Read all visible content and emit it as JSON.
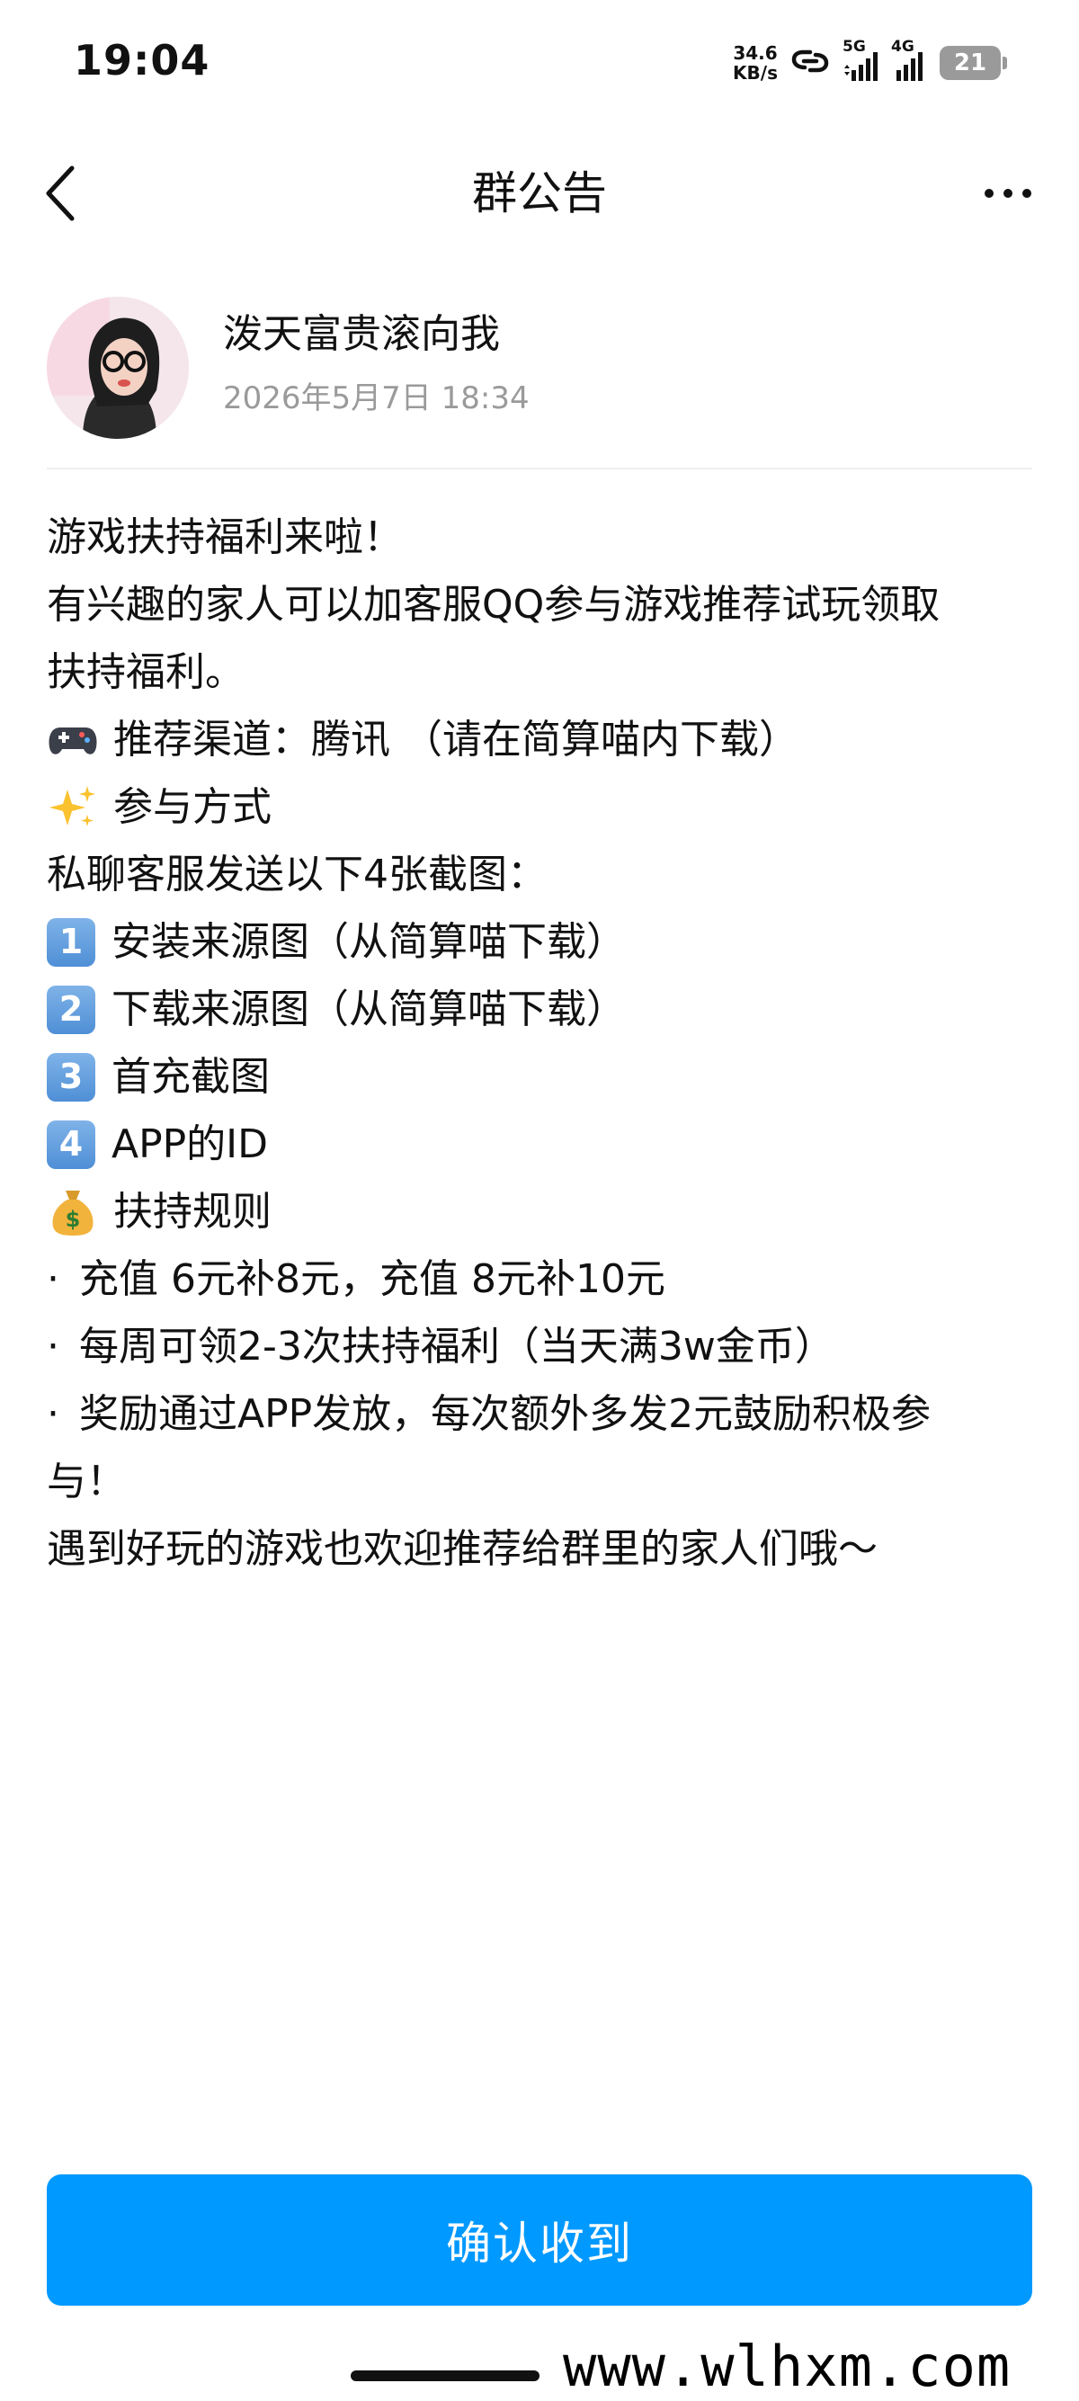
{
  "status_bar": {
    "time": "19:04",
    "net_speed_value": "34.6",
    "net_speed_unit": "KB/s",
    "signal1_label": "5G",
    "signal2_label": "4G",
    "battery_level": "21"
  },
  "nav": {
    "title": "群公告"
  },
  "author": {
    "name": "泼天富贵滚向我",
    "date": "2026年5月7日 18:34"
  },
  "announcement": {
    "lines": [
      "游戏扶持福利来啦！",
      "有兴趣的家人可以加客服QQ参与游戏推荐试玩领取",
      "扶持福利。",
      "推荐渠道：腾讯 （请在简算喵内下载）",
      "参与方式",
      "私聊客服发送以下4张截图：",
      "安装来源图（从简算喵下载）",
      "下载来源图（从简算喵下载）",
      "首充截图",
      "APP的ID",
      "扶持规则",
      "充值 6元补8元，充值 8元补10元",
      "每周可领2-3次扶持福利（当天满3w金币）",
      "奖励通过APP发放，每次额外多发2元鼓励积极参",
      "与！",
      "遇到好玩的游戏也欢迎推荐给群里的家人们哦～"
    ],
    "bullet": "·",
    "keycap_1": "1",
    "keycap_2": "2",
    "keycap_3": "3",
    "keycap_4": "4"
  },
  "confirm_button": {
    "label": "确认收到"
  },
  "watermark": {
    "text": "www.wlhxm.com"
  },
  "colors": {
    "accent": "#0099ff",
    "date_gray": "#9a9a9a"
  },
  "icons": [
    "back-chevron-icon",
    "more-dots-icon",
    "gamepad-icon",
    "sparkles-icon",
    "money-bag-icon",
    "link-icon",
    "signal-icon"
  ]
}
